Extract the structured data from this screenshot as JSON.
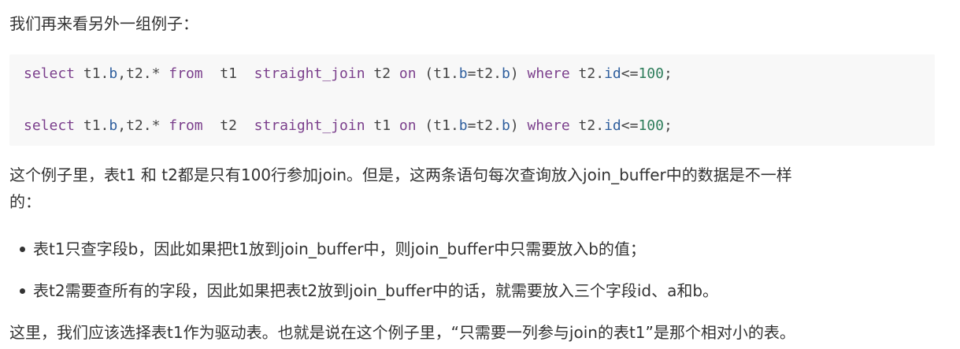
{
  "intro": "我们再来看另外一组例子：",
  "code": {
    "line1": {
      "kw_select": "select",
      "seg1": " t1.",
      "col_b1": "b",
      "seg2": ",t2.* ",
      "kw_from": "from",
      "seg3": "  t1  ",
      "kw_join": "straight_join",
      "seg4": " t2 ",
      "kw_on": "on",
      "seg5": " (t1.",
      "col_b2": "b",
      "seg6": "=t2.",
      "col_b3": "b",
      "seg7": ") ",
      "kw_where": "where",
      "seg8": " t2.",
      "col_id": "id",
      "seg9": "<=",
      "num": "100",
      "seg10": ";"
    },
    "line2": {
      "kw_select": "select",
      "seg1": " t1.",
      "col_b1": "b",
      "seg2": ",t2.* ",
      "kw_from": "from",
      "seg3": "  t2  ",
      "kw_join": "straight_join",
      "seg4": " t1 ",
      "kw_on": "on",
      "seg5": " (t1.",
      "col_b2": "b",
      "seg6": "=t2.",
      "col_b3": "b",
      "seg7": ") ",
      "kw_where": "where",
      "seg8": " t2.",
      "col_id": "id",
      "seg9": "<=",
      "num": "100",
      "seg10": ";"
    }
  },
  "para2_line1": "这个例子里，表t1 和 t2都是只有100行参加join。但是，这两条语句每次查询放入join_buffer中的数据是不一样",
  "para2_line2": "的：",
  "bullets": [
    "表t1只查字段b，因此如果把t1放到join_buffer中，则join_buffer中只需要放入b的值；",
    "表t2需要查所有的字段，因此如果把表t2放到join_buffer中的话，就需要放入三个字段id、a和b。"
  ],
  "para3": "这里，我们应该选择表t1作为驱动表。也就是说在这个例子里，“只需要一列参与join的表t1”是那个相对小的表。"
}
